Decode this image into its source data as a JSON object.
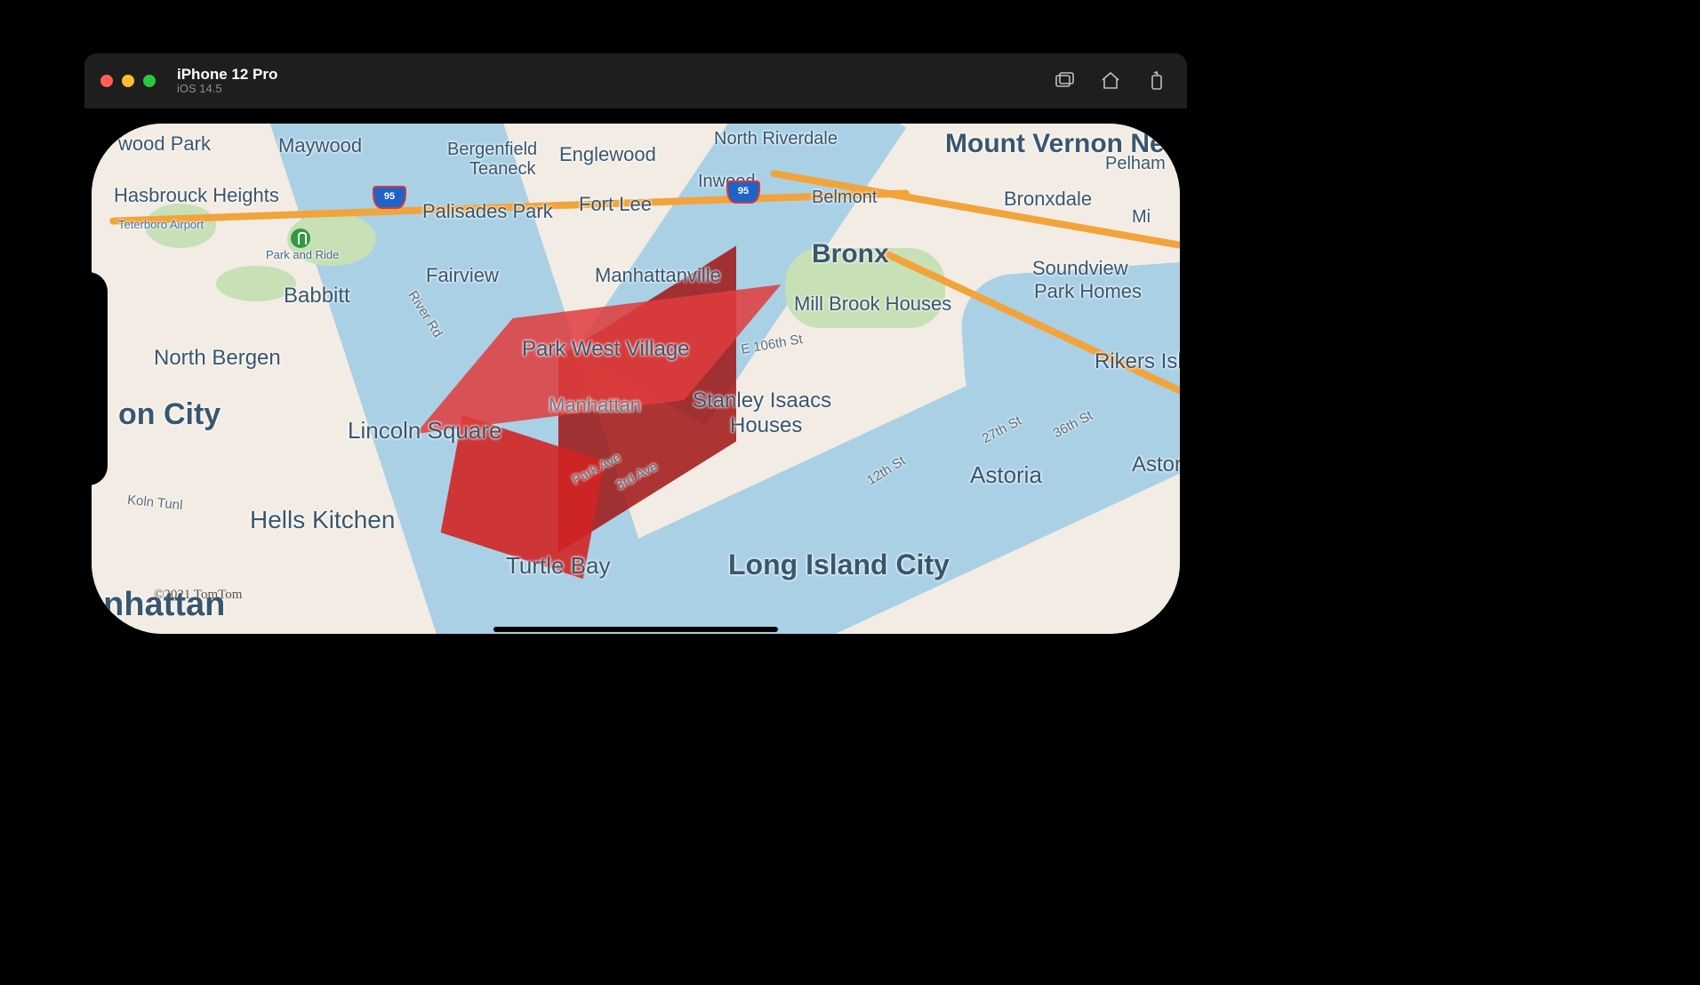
{
  "window": {
    "device": "iPhone 12 Pro",
    "os": "iOS 14.5"
  },
  "toolbar": {
    "screenshot": "screenshot-icon",
    "home": "home-icon",
    "rotate": "rotate-icon"
  },
  "map": {
    "attribution": "©2021 TomTom",
    "overlay": {
      "name": "red-3d-extrusion",
      "color": "#c81e1e"
    },
    "highway_shields": {
      "i95": "95"
    },
    "poi": {
      "park_and_ride": "Park and Ride",
      "teterboro": "Teterboro Airport"
    },
    "streets": {
      "e106": "E 106th St",
      "park_ave": "Park Ave",
      "third_ave": "3rd Ave",
      "twelfth": "12th St",
      "twentyseventh": "27th St",
      "thirtysixth": "36th St",
      "river_rd": "River Rd",
      "koln_tunl": "Koln Tunl"
    },
    "labels": {
      "mount_vernon": "Mount Vernon New",
      "pelham": "Pelham",
      "bronx": "Bronx",
      "north_riverdale": "North Riverdale",
      "belmont": "Belmont",
      "bronxdale": "Bronxdale",
      "mi": "Mi",
      "soundview": "Soundview",
      "park_homes": "Park Homes",
      "mill_brook": "Mill Brook Houses",
      "rikers": "Rikers Isla",
      "astoria": "Astoria",
      "astoria2": "Astoria",
      "long_island_city": "Long Island City",
      "stanley_isaacs": "Stanley Isaacs",
      "houses": "Houses",
      "manhattan": "Manhattan",
      "manhattan_big": "anhattan",
      "manhattanville": "Manhattanville",
      "park_west": "Park West Village",
      "lincoln_square": "Lincoln Square",
      "hells_kitchen": "Hells Kitchen",
      "turtle_bay": "Turtle Bay",
      "on_city": "on City",
      "north_bergen": "North Bergen",
      "babbit": "Babbitt",
      "fairview": "Fairview",
      "wood_park": "wood Park",
      "maywood": "Maywood",
      "hasbrouck": "Hasbrouck Heights",
      "teaneck": "Teaneck",
      "englewood": "Englewood",
      "bergenfield": "Bergenfield",
      "palisades": "Palisades Park",
      "fort_lee": "Fort Lee",
      "inwood": "Inwood"
    }
  }
}
